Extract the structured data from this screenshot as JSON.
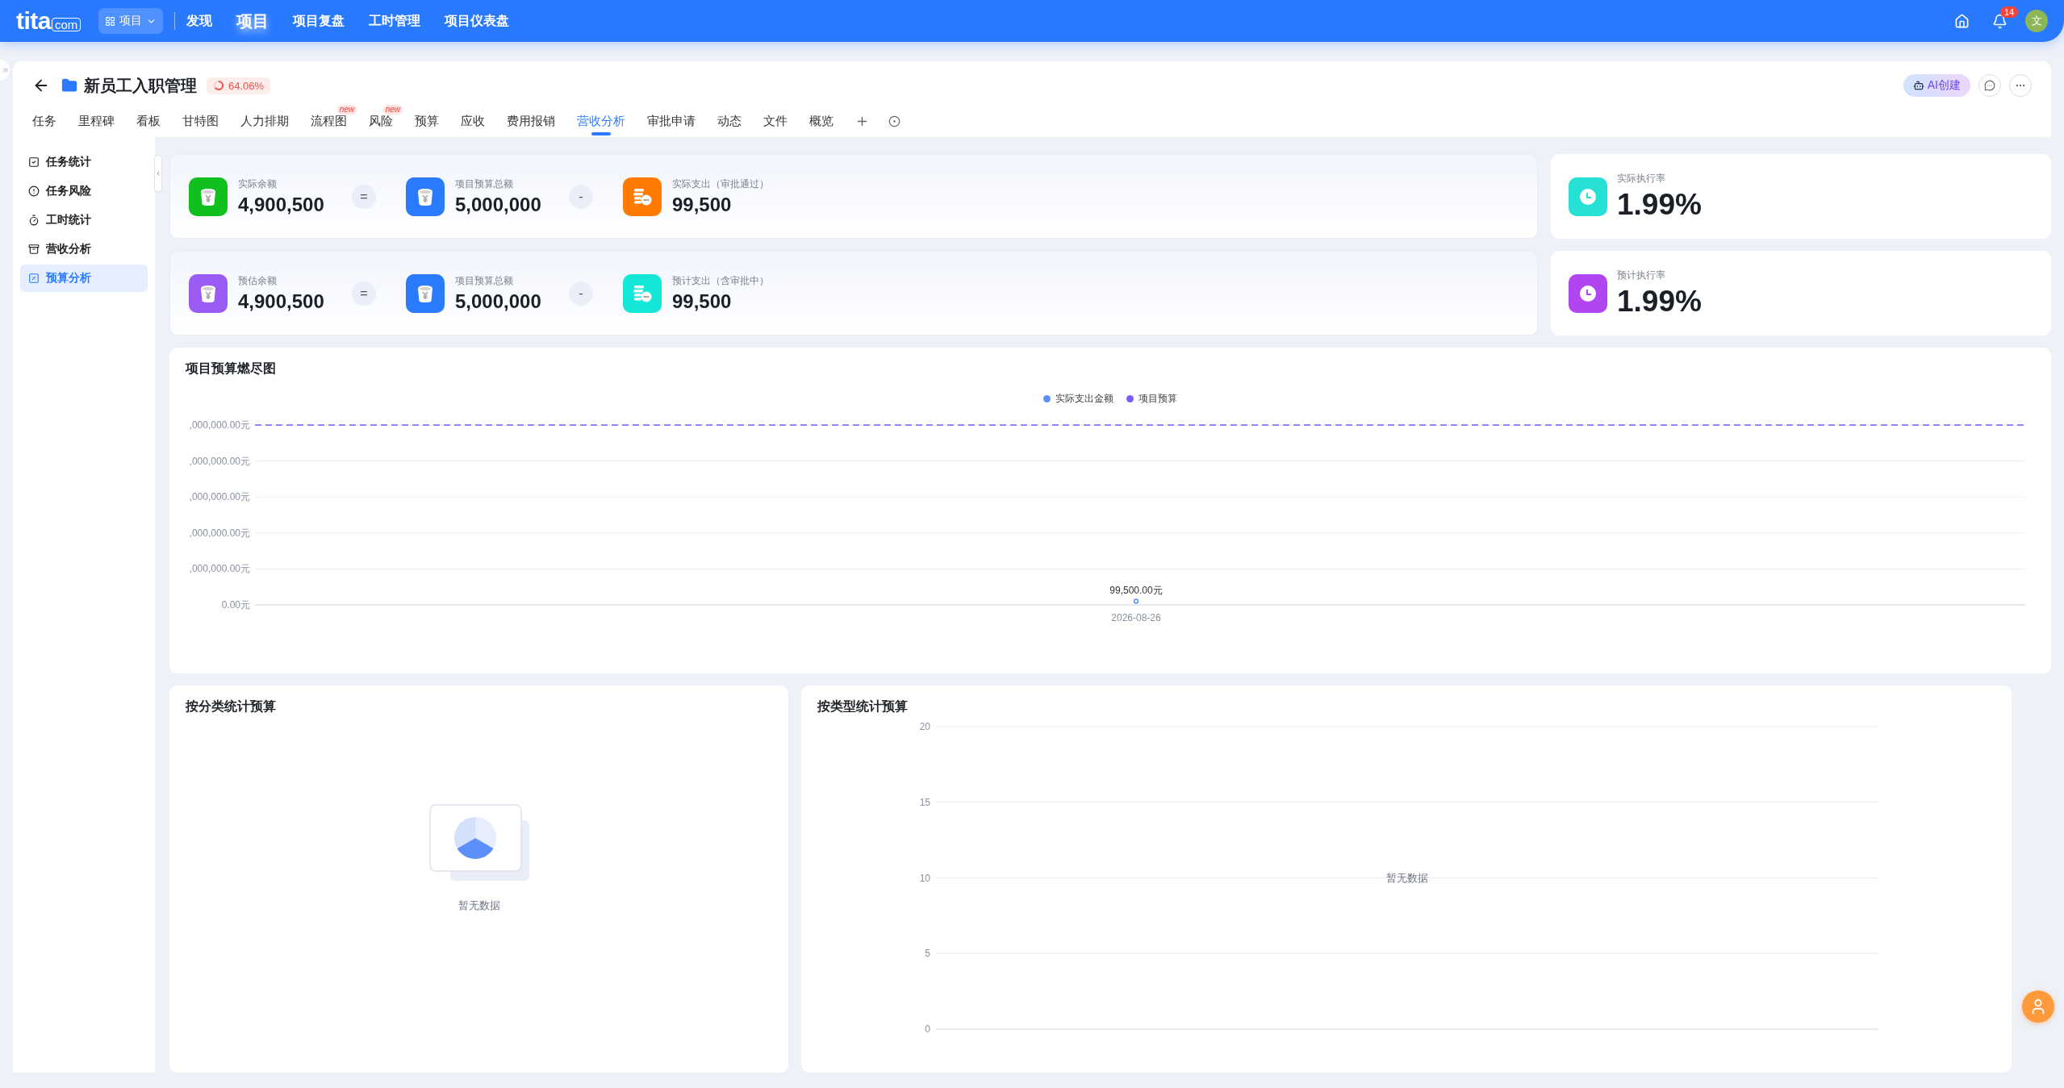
{
  "top_bar": {
    "logo": {
      "main": "tita",
      "suffix": "com"
    },
    "module_switch": {
      "label": "项目"
    },
    "nav": [
      {
        "label": "发现",
        "selected": false
      },
      {
        "label": "项目",
        "selected": true
      },
      {
        "label": "项目复盘",
        "selected": false
      },
      {
        "label": "工时管理",
        "selected": false
      },
      {
        "label": "项目仪表盘",
        "selected": false
      }
    ],
    "notifications": {
      "badge": "14"
    },
    "avatar": {
      "initial": "文"
    }
  },
  "project": {
    "title": "新员工入职管理",
    "progress": {
      "label": "64.06%",
      "level": 0.6406
    },
    "ai_button": "AI创建"
  },
  "tabs": [
    {
      "label": "任务",
      "selected": false
    },
    {
      "label": "里程碑",
      "selected": false
    },
    {
      "label": "看板",
      "selected": false
    },
    {
      "label": "甘特图",
      "selected": false
    },
    {
      "label": "人力排期",
      "selected": false
    },
    {
      "label": "流程图",
      "selected": false,
      "badge": "new"
    },
    {
      "label": "风险",
      "selected": false,
      "badge": "new"
    },
    {
      "label": "预算",
      "selected": false
    },
    {
      "label": "应收",
      "selected": false
    },
    {
      "label": "费用报销",
      "selected": false
    },
    {
      "label": "营收分析",
      "selected": true
    },
    {
      "label": "审批申请",
      "selected": false
    },
    {
      "label": "动态",
      "selected": false
    },
    {
      "label": "文件",
      "selected": false
    },
    {
      "label": "概览",
      "selected": false
    }
  ],
  "sidebar": {
    "items": [
      {
        "label": "任务统计",
        "selected": false
      },
      {
        "label": "任务风险",
        "selected": false
      },
      {
        "label": "工时统计",
        "selected": false
      },
      {
        "label": "营收分析",
        "selected": false
      },
      {
        "label": "预算分析",
        "selected": true
      }
    ]
  },
  "balance_rows": [
    {
      "terms": [
        {
          "kind": "stat",
          "color": "#10c01c",
          "label": "实际余额",
          "value": "4,900,500"
        },
        {
          "kind": "operator",
          "symbol": "="
        },
        {
          "kind": "stat",
          "color": "#2b7bff",
          "label": "项目预算总额",
          "value": "5,000,000"
        },
        {
          "kind": "operator",
          "symbol": "-"
        },
        {
          "kind": "stat",
          "color": "#ff7a00",
          "label": "实际支出（审批通过）",
          "value": "99,500"
        }
      ]
    },
    {
      "terms": [
        {
          "kind": "stat",
          "color": "#9b5cf6",
          "label": "预估余额",
          "value": "4,900,500"
        },
        {
          "kind": "operator",
          "symbol": "="
        },
        {
          "kind": "stat",
          "color": "#2b7bff",
          "label": "项目预算总额",
          "value": "5,000,000"
        },
        {
          "kind": "operator",
          "symbol": "-"
        },
        {
          "kind": "stat",
          "color": "#14e6d8",
          "label": "预计支出（含审批中）",
          "value": "99,500"
        }
      ]
    }
  ],
  "rate_cards": [
    {
      "color": "#26e0d6",
      "label": "实际执行率",
      "value": "1.99%"
    },
    {
      "color": "#b145f0",
      "label": "预计执行率",
      "value": "1.99%"
    }
  ],
  "burndown": {
    "title": "项目预算燃尽图",
    "y_axis_labels": [
      ",000,000.00元",
      ",000,000.00元",
      ",000,000.00元",
      ",000,000.00元",
      ",000,000.00元",
      "0.00元"
    ],
    "x_axis_labels": [
      "2026-08-26"
    ],
    "legend": [
      {
        "name": "实际支出金额",
        "color": "#5b8ff9"
      },
      {
        "name": "项目预算",
        "color": "#7b5cf5"
      }
    ],
    "point_label": "99,500.00元"
  },
  "category_budget": {
    "title": "按分类统计预算",
    "empty_text": "暂无数据"
  },
  "type_budget": {
    "title": "按类型统计预算",
    "empty_text": "暂无数据",
    "y_axis_labels": [
      "20",
      "15",
      "10",
      "5",
      "0"
    ]
  }
}
